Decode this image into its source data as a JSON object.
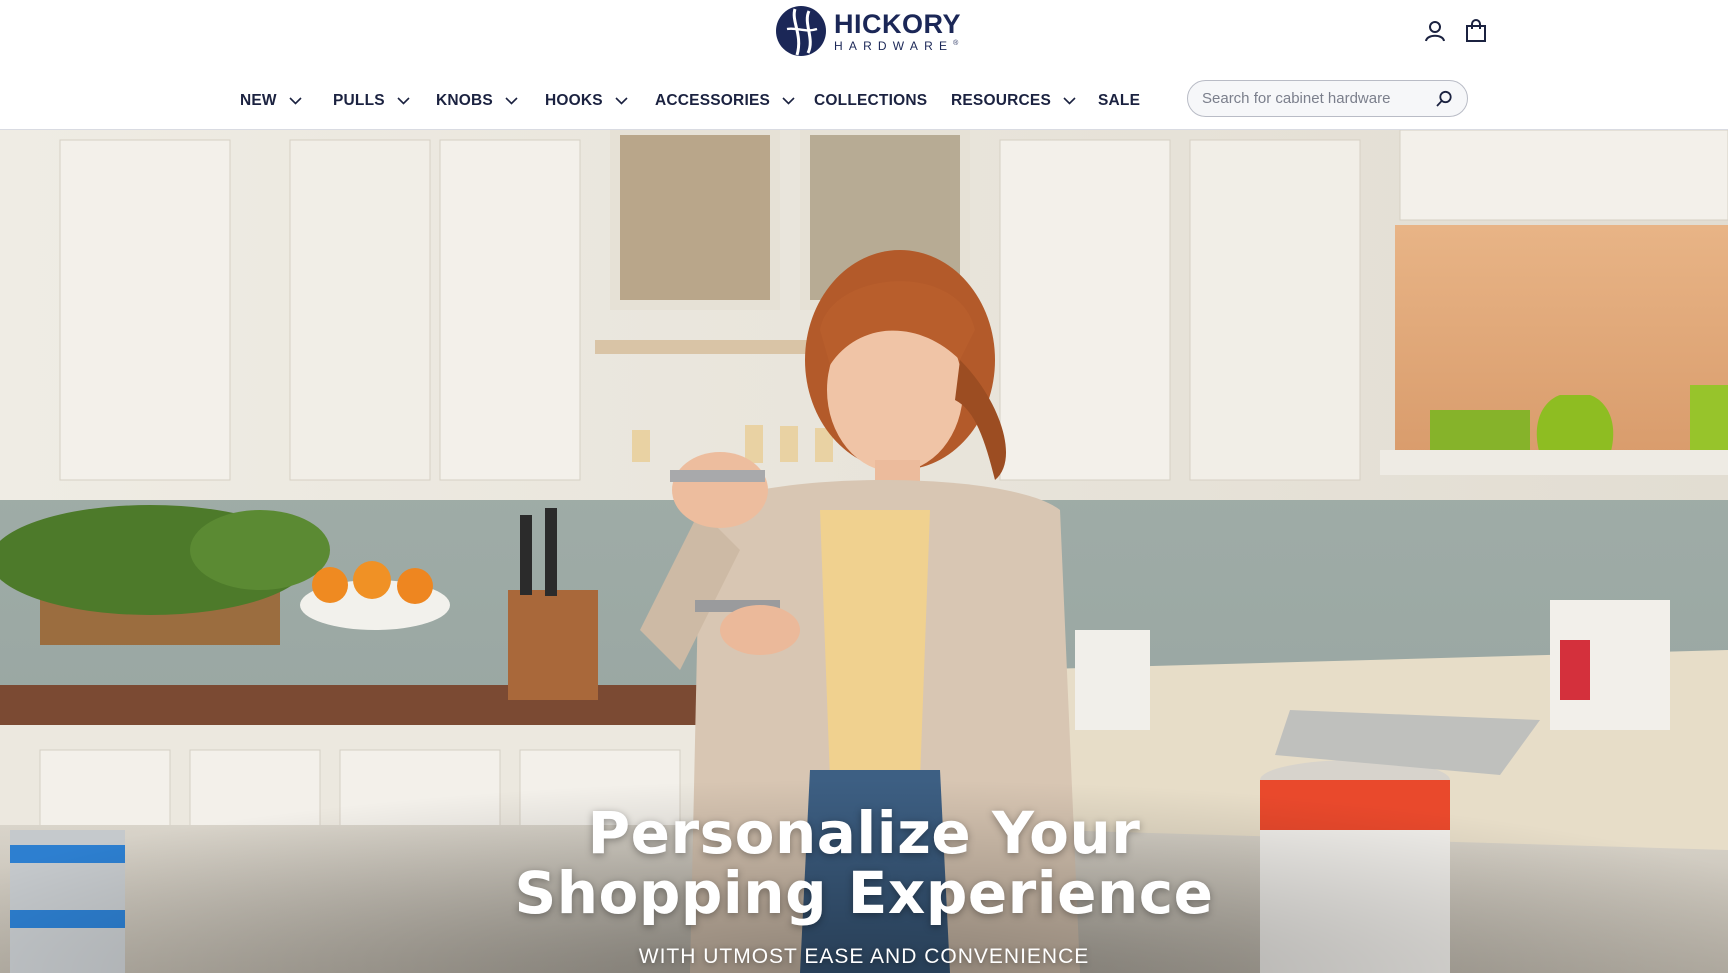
{
  "brand": {
    "name_line1": "HICKORY",
    "name_line2": "HARDWARE",
    "trademark": "®",
    "logo_icon": "hickory-leaf-icon",
    "colors": {
      "navy": "#1b2757"
    }
  },
  "header": {
    "account_icon": "user-icon",
    "cart_icon": "shopping-bag-icon"
  },
  "nav": {
    "items": [
      {
        "label": "NEW",
        "has_dropdown": true
      },
      {
        "label": "PULLS",
        "has_dropdown": true
      },
      {
        "label": "KNOBS",
        "has_dropdown": true
      },
      {
        "label": "HOOKS",
        "has_dropdown": true
      },
      {
        "label": "ACCESSORIES",
        "has_dropdown": true
      },
      {
        "label": "COLLECTIONS",
        "has_dropdown": false
      },
      {
        "label": "RESOURCES",
        "has_dropdown": true
      },
      {
        "label": "SALE",
        "has_dropdown": false
      }
    ]
  },
  "search": {
    "placeholder": "Search for cabinet hardware",
    "value": "",
    "icon": "search-icon"
  },
  "hero": {
    "title_line1": "Personalize Your",
    "title_line2": "Shopping Experience",
    "subtitle": "WITH UTMOST EASE AND CONVENIENCE"
  }
}
